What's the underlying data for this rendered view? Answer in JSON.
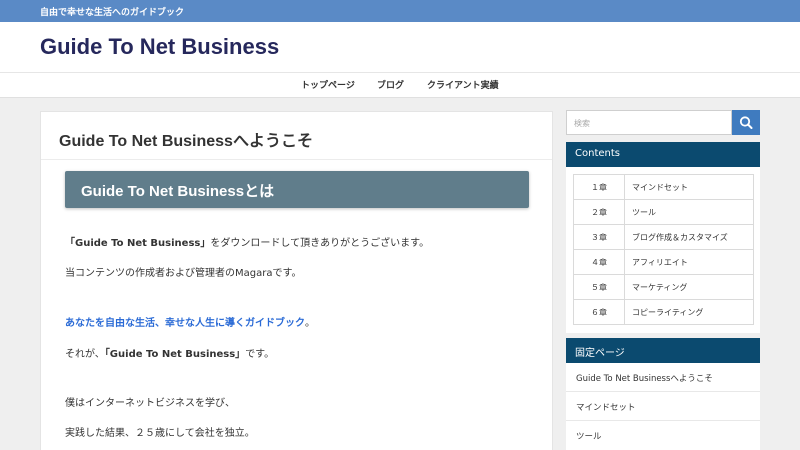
{
  "topbar": {
    "tagline": "自由で幸せな生活へのガイドブック"
  },
  "header": {
    "site_title": "Guide To Net Business"
  },
  "nav": {
    "items": [
      "トップページ",
      "ブログ",
      "クライアント実績"
    ]
  },
  "main": {
    "page_title": "Guide To Net Businessへようこそ",
    "section_heading": "Guide To Net Businessとは",
    "para1_strong": "「Guide To Net Business」",
    "para1_rest": "をダウンロードして頂きありがとうございます。",
    "para2": "当コンテンツの作成者および管理者のMagaraです。",
    "para3_highlight": "あなたを自由な生活、幸せな人生に導くガイドブック",
    "para3_end": "。",
    "para4_start": "それが、",
    "para4_strong": "「Guide To Net Business」",
    "para4_end": "です。",
    "para5": "僕はインターネットビジネスを学び、",
    "para6": "実践した結果、２５歳にして会社を独立。"
  },
  "sidebar": {
    "search": {
      "placeholder": "検索"
    },
    "contents": {
      "title": "Contents",
      "rows": [
        {
          "num": "１章",
          "label": "マインドセット"
        },
        {
          "num": "２章",
          "label": "ツール"
        },
        {
          "num": "３章",
          "label": "ブログ作成＆カスタマイズ"
        },
        {
          "num": "４章",
          "label": "アフィリエイト"
        },
        {
          "num": "５章",
          "label": "マーケティング"
        },
        {
          "num": "６章",
          "label": "コピーライティング"
        }
      ]
    },
    "fixed_pages": {
      "title": "固定ページ",
      "items": [
        "Guide To Net Businessへようこそ",
        "マインドセット",
        "ツール"
      ]
    }
  },
  "colors": {
    "topbar": "#5a8ac6",
    "site_title": "#26285c",
    "section_heading": "#607d8b",
    "widget_header": "#0b4a6f",
    "search_button": "#3f7bbf",
    "highlight_text": "#2b6bd6"
  },
  "icons": {
    "search_button": "search-icon"
  }
}
